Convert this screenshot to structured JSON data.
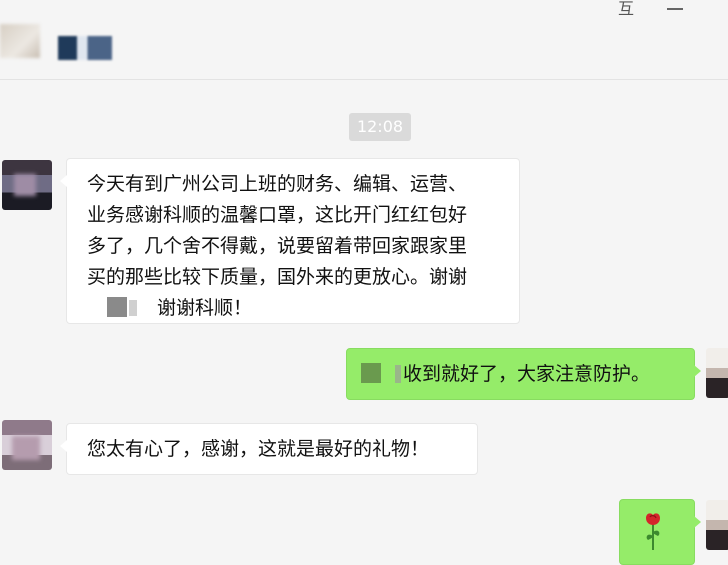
{
  "header": {
    "pin_icon": "pin-icon",
    "minimize_icon": "minimize-icon"
  },
  "timestamp": "12:08",
  "messages": [
    {
      "side": "left",
      "lines": [
        "今天有到广州公司上班的财务、编辑、运营、",
        "业务感谢科顺的温馨口罩，这比开门红红包好",
        "多了，几个舍不得戴，说要留着带回家跟家里",
        "买的那些比较下质量，国外来的更放心。谢谢",
        "谢谢科顺！"
      ]
    },
    {
      "side": "right",
      "text": "收到就好了，大家注意防护。"
    },
    {
      "side": "left",
      "text": "您太有心了，感谢，这就是最好的礼物！"
    },
    {
      "side": "right",
      "icon": "rose-icon"
    }
  ],
  "colors": {
    "background": "#f5f5f5",
    "bubble_self": "#95ec69",
    "bubble_other": "#ffffff",
    "timestamp_bg": "#dadada"
  }
}
